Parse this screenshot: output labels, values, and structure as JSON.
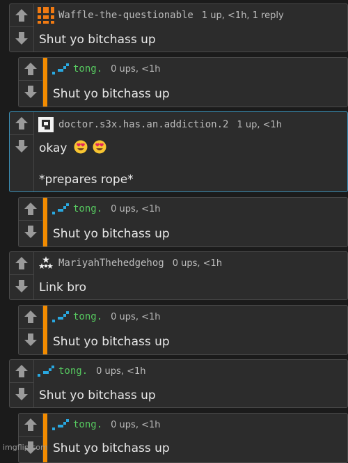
{
  "comments": [
    {
      "user": "Waffle-the-questionable",
      "meta": "1 up, <1h, 1 reply",
      "body": "Shut yo bitchass up",
      "avatar": "orange-waffle-avatar"
    },
    {
      "user": "tong.",
      "meta": "0 ups, <1h",
      "body": "Shut yo bitchass up",
      "avatar": "blue-pixel-avatar"
    },
    {
      "user": "doctor.s3x.has.an.addiction.2",
      "meta": "1 up, <1h",
      "body": "okay",
      "body2": "*prepares rope*",
      "avatar": "white-frame-avatar"
    },
    {
      "user": "tong.",
      "meta": "0 ups, <1h",
      "body": "Shut yo bitchass up",
      "avatar": "blue-pixel-avatar"
    },
    {
      "user": "MariyahThehedgehog",
      "meta": "0 ups, <1h",
      "body": "Link bro",
      "avatar": "stars-avatar"
    },
    {
      "user": "tong.",
      "meta": "0 ups, <1h",
      "body": "Shut yo bitchass up",
      "avatar": "blue-pixel-avatar"
    },
    {
      "user": "tong.",
      "meta": "0 ups, <1h",
      "body": "Shut yo bitchass up",
      "avatar": "blue-pixel-avatar"
    },
    {
      "user": "tong.",
      "meta": "0 ups, <1h",
      "body": "Shut yo bitchass up",
      "avatar": "blue-pixel-avatar"
    }
  ],
  "watermark": "imgflip.com",
  "colors": {
    "accent_bar": "#f28b00",
    "highlight_border": "#3a8fb5",
    "username_green": "#56c85f"
  },
  "icons": {
    "upvote": "up-arrow-icon",
    "downvote": "down-arrow-icon",
    "emoji": "heart-eyes-emoji"
  }
}
